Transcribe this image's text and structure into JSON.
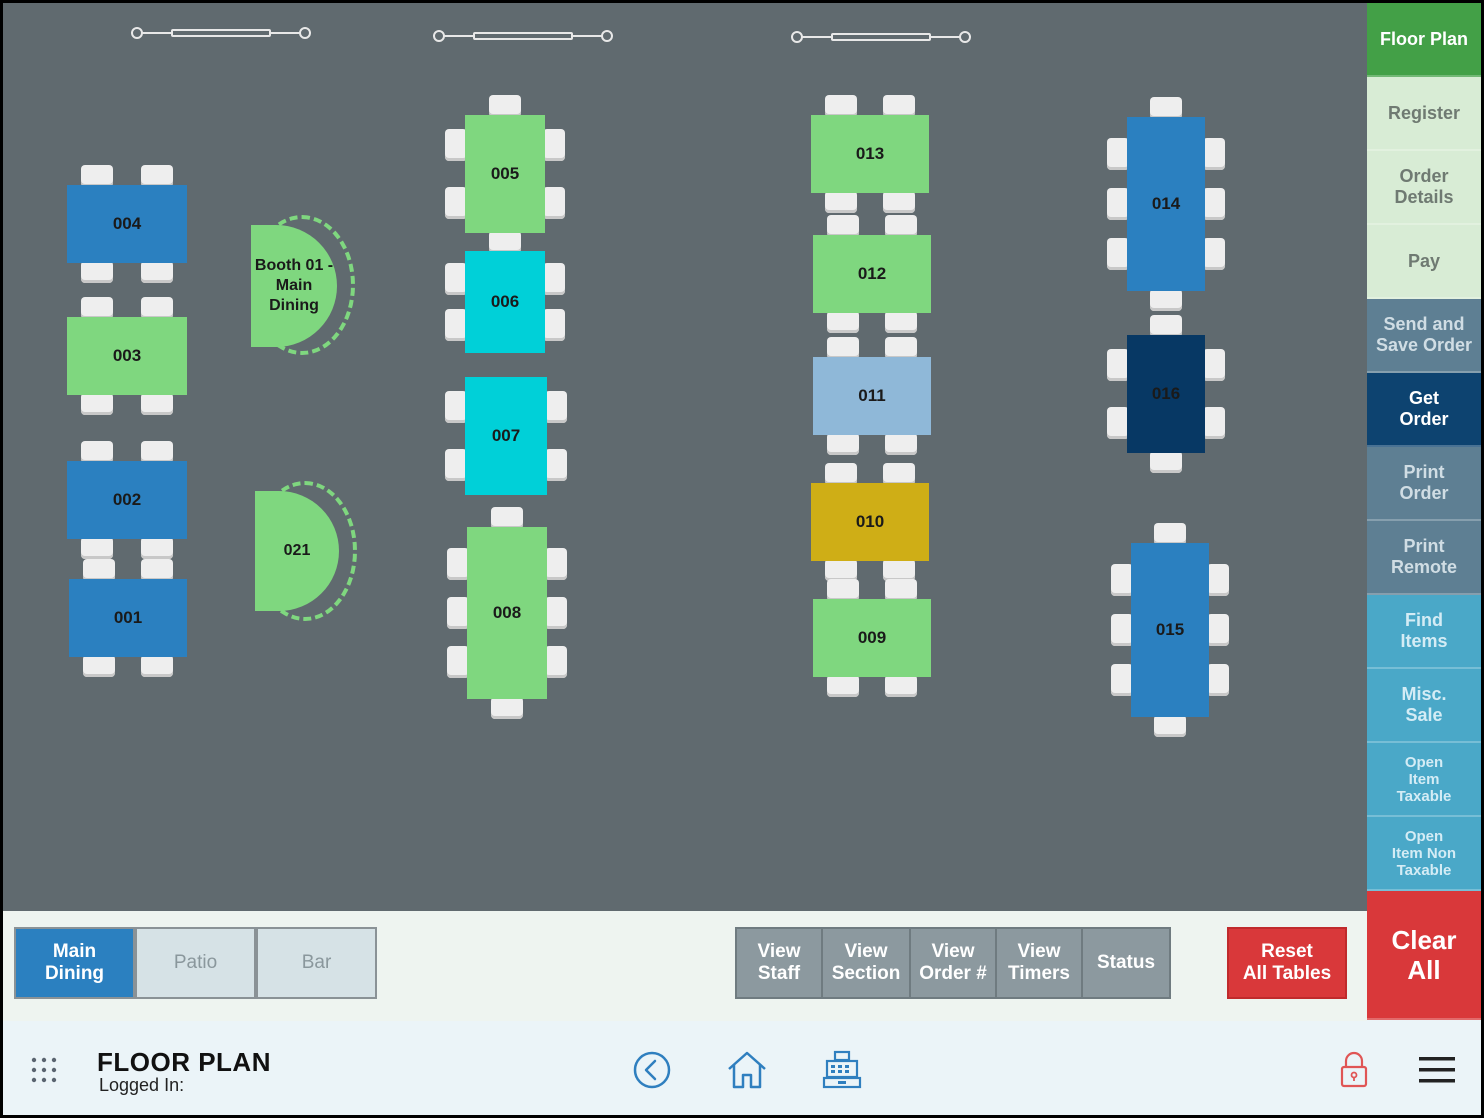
{
  "colors": {
    "floor": "#606a6f",
    "available": "#7fd77f",
    "occupied": "#2b80c0",
    "seated": "#00d0d8",
    "reserved": "#8fb8d8",
    "billed": "#cfae16",
    "selected": "#073864"
  },
  "tables": [
    {
      "id": "004",
      "label": "004",
      "status": "occupied"
    },
    {
      "id": "003",
      "label": "003",
      "status": "available"
    },
    {
      "id": "002",
      "label": "002",
      "status": "occupied"
    },
    {
      "id": "001",
      "label": "001",
      "status": "occupied"
    },
    {
      "id": "005",
      "label": "005",
      "status": "available"
    },
    {
      "id": "006",
      "label": "006",
      "status": "seated"
    },
    {
      "id": "007",
      "label": "007",
      "status": "seated"
    },
    {
      "id": "008",
      "label": "008",
      "status": "available"
    },
    {
      "id": "013",
      "label": "013",
      "status": "available"
    },
    {
      "id": "012",
      "label": "012",
      "status": "available"
    },
    {
      "id": "011",
      "label": "011",
      "status": "reserved"
    },
    {
      "id": "010",
      "label": "010",
      "status": "billed"
    },
    {
      "id": "009",
      "label": "009",
      "status": "available"
    },
    {
      "id": "014",
      "label": "014",
      "status": "occupied"
    },
    {
      "id": "016",
      "label": "016",
      "status": "selected"
    },
    {
      "id": "015",
      "label": "015",
      "status": "occupied"
    }
  ],
  "booths": [
    {
      "id": "booth-01",
      "label": "Booth 01 -\nMain\nDining",
      "status": "available"
    },
    {
      "id": "021",
      "label": "021",
      "status": "available"
    }
  ],
  "sidebar": {
    "items": [
      {
        "label": "Floor Plan",
        "bg": "#43a047",
        "fg": "#ffffff",
        "active": true
      },
      {
        "label": "Register",
        "bg": "#d8ecd5",
        "fg": "#6f7a72"
      },
      {
        "label": "Order\nDetails",
        "bg": "#d8ecd5",
        "fg": "#6f7a72"
      },
      {
        "label": "Pay",
        "bg": "#d8ecd5",
        "fg": "#6f7a72"
      },
      {
        "label": "Send and\nSave Order",
        "bg": "#5e7f93",
        "fg": "#d0dde4"
      },
      {
        "label": "Get\nOrder",
        "bg": "#0d4370",
        "fg": "#ffffff"
      },
      {
        "label": "Print\nOrder",
        "bg": "#5e7f93",
        "fg": "#d0dde4"
      },
      {
        "label": "Print\nRemote",
        "bg": "#5e7f93",
        "fg": "#d0dde4"
      },
      {
        "label": "Find\nItems",
        "bg": "#4aa8c8",
        "fg": "#d4ecf5"
      },
      {
        "label": "Misc.\nSale",
        "bg": "#4aa8c8",
        "fg": "#d4ecf5"
      },
      {
        "label": "Open\nItem\nTaxable",
        "bg": "#4aa8c8",
        "fg": "#d4ecf5"
      },
      {
        "label": "Open\nItem Non\nTaxable",
        "bg": "#4aa8c8",
        "fg": "#d4ecf5"
      },
      {
        "label": "Clear\nAll",
        "bg": "#d9383a",
        "fg": "#ffffff"
      }
    ]
  },
  "zones": [
    {
      "label": "Main\nDining",
      "active": true
    },
    {
      "label": "Patio",
      "active": false
    },
    {
      "label": "Bar",
      "active": false
    }
  ],
  "view_buttons": [
    {
      "label": "View\nStaff"
    },
    {
      "label": "View\nSection"
    },
    {
      "label": "View\nOrder #"
    },
    {
      "label": "View\nTimers"
    },
    {
      "label": "Status"
    }
  ],
  "reset_button": {
    "label": "Reset\nAll Tables"
  },
  "footer": {
    "title": "FLOOR PLAN",
    "logged_in": "Logged In:",
    "icons": [
      "apps-grid-icon",
      "back-icon",
      "home-icon",
      "cash-register-icon",
      "lock-icon",
      "menu-icon"
    ]
  }
}
